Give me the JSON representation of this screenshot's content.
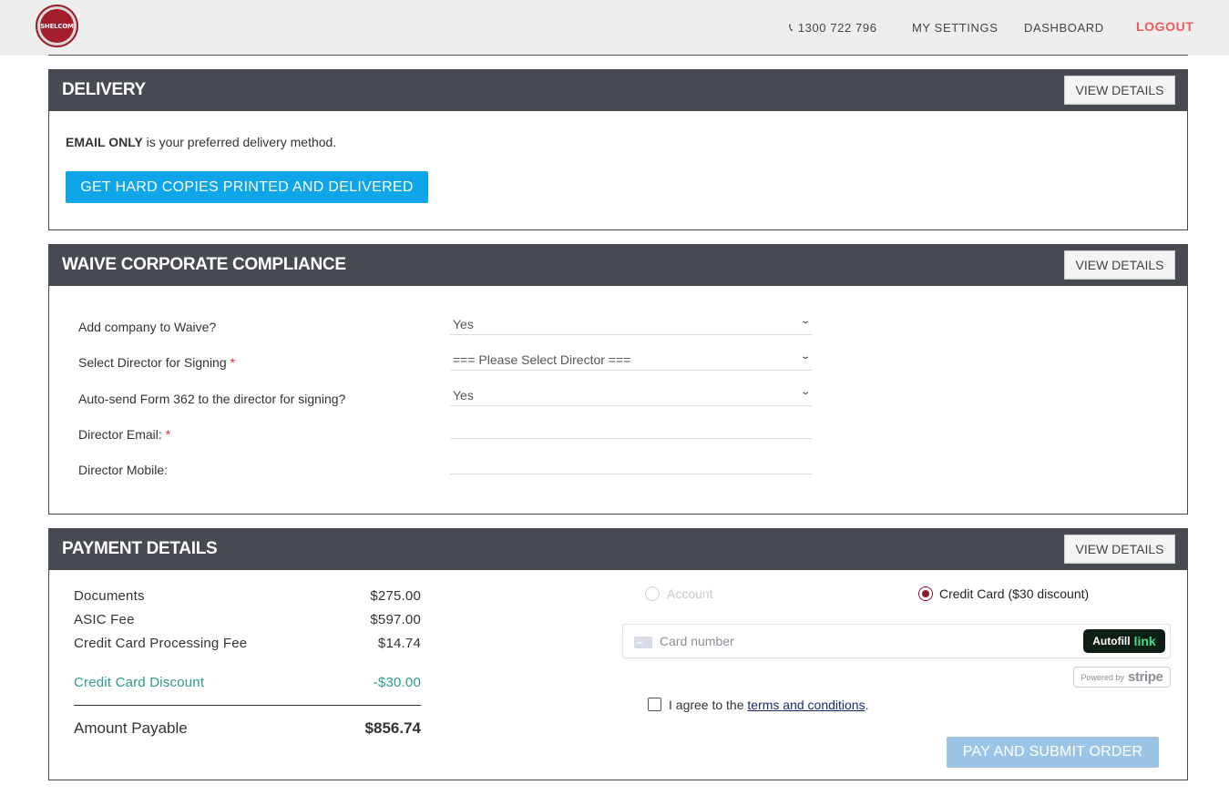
{
  "brand": {
    "logo_text": "SHELCOM",
    "accent": "#a31d2a"
  },
  "nav": {
    "phone": "1300 722 796",
    "settings": "MY SETTINGS",
    "dashboard": "DASHBOARD",
    "logout": "LOGOUT"
  },
  "delivery": {
    "title": "DELIVERY",
    "view_details": "VIEW DETAILS",
    "method_bold": "EMAIL ONLY",
    "method_text": " is your preferred delivery method.",
    "hardcopy_button": "GET HARD COPIES PRINTED AND DELIVERED"
  },
  "waive": {
    "title": "WAIVE CORPORATE COMPLIANCE",
    "view_details": "VIEW DETAILS",
    "fields": {
      "add_company_label": "Add company to Waive?",
      "add_company_value": "Yes",
      "director_label": "Select Director for Signing ",
      "director_value": "=== Please Select Director ===",
      "autosend_label": "Auto-send Form 362 to the director for signing?",
      "autosend_value": "Yes",
      "email_label": "Director Email: ",
      "email_value": "",
      "mobile_label": "Director Mobile:",
      "mobile_value": ""
    },
    "required_mark": "*"
  },
  "payment": {
    "title": "PAYMENT DETAILS",
    "view_details": "VIEW DETAILS",
    "lines": [
      {
        "label": "Documents",
        "amount": "$275.00"
      },
      {
        "label": "ASIC Fee",
        "amount": "$597.00"
      },
      {
        "label": "Credit Card Processing Fee",
        "amount": "$14.74"
      }
    ],
    "discount": {
      "label": "Credit Card Discount",
      "amount": "-$30.00"
    },
    "total": {
      "label": "Amount Payable",
      "amount": "$856.74"
    },
    "option_account": "Account",
    "option_card": "Credit Card ($30 discount)",
    "card_placeholder": "Card number",
    "autofill": "Autofill",
    "autofill_link": "link",
    "powered_by": "Powered by",
    "stripe": "stripe",
    "agree_prefix": "I agree to the ",
    "terms_link": "terms and conditions",
    "agree_suffix": ".",
    "submit": "PAY AND SUBMIT ORDER"
  }
}
